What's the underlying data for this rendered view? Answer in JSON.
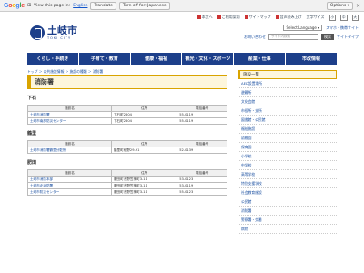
{
  "translate_bar": {
    "logo": "Google",
    "view_text": "View this page in:",
    "language": "English",
    "translate_label": "Translate",
    "turn_off_label": "Turn off for: Japanese",
    "options_label": "Options ▾",
    "close": "×"
  },
  "top_links": {
    "chinese_label": "日",
    "items": [
      "本文へ",
      "ご利用案内",
      "サイトマップ",
      "音声読み上げ",
      "読み上げ 拡大"
    ],
    "size_label": "文字サイズ",
    "size_buttons": [
      "小",
      "中",
      "大"
    ]
  },
  "header": {
    "logo_kanji": "土岐市",
    "logo_roman": "TOKI CITY",
    "language_select": "Select Language",
    "mobile_link": "スマホ・携帯サイト",
    "inquiry_link": "お問い合わせ",
    "search_placeholder": "サイト内検索",
    "search_button": "検索",
    "type_link": "サイトタイプ"
  },
  "nav": [
    "くらし・手続き",
    "子育て・教育",
    "健康・福祉",
    "観光・文化・スポーツ",
    "産業・仕事",
    "市政情報"
  ],
  "breadcrumb": "トップ ＞ 公共施設情報 ＞ 施設の種類 ＞ 消防署",
  "page_title": "消防署",
  "table_headers": [
    "施設名",
    "住所",
    "電話番号"
  ],
  "sections": [
    {
      "heading": "下石",
      "rows": [
        [
          "土岐市消防署",
          "下石町2604",
          "55-0119"
        ],
        [
          "土岐市南部防災センター",
          "下石町2604",
          "55-0119"
        ]
      ]
    },
    {
      "heading": "鶴里",
      "rows": [
        [
          "土岐市消防署鶴里分駐所",
          "鶴里町細野29-91",
          "52-0139"
        ]
      ]
    },
    {
      "heading": "肥田",
      "rows": [
        [
          "土岐市消防本部",
          "肥田町浅野笠神町3-11",
          "53-0123"
        ],
        [
          "土岐市北消防署",
          "肥田町浅野笠神町3-11",
          "53-0119"
        ],
        [
          "土岐市防災センター",
          "肥田町浅野笠神町3-11",
          "55-0123"
        ]
      ]
    }
  ],
  "sidebar": {
    "title": "施設一覧",
    "items": [
      "AED設置場所",
      "避難所",
      "文化会館",
      "市役所・支所",
      "図書館・公民館",
      "福祉施設",
      "幼稚園",
      "保育園",
      "小学校",
      "中学校",
      "高等学校",
      "特別支援学校",
      "社会教育施設",
      "公民館",
      "消防署",
      "警察署・交番",
      "病院"
    ]
  }
}
